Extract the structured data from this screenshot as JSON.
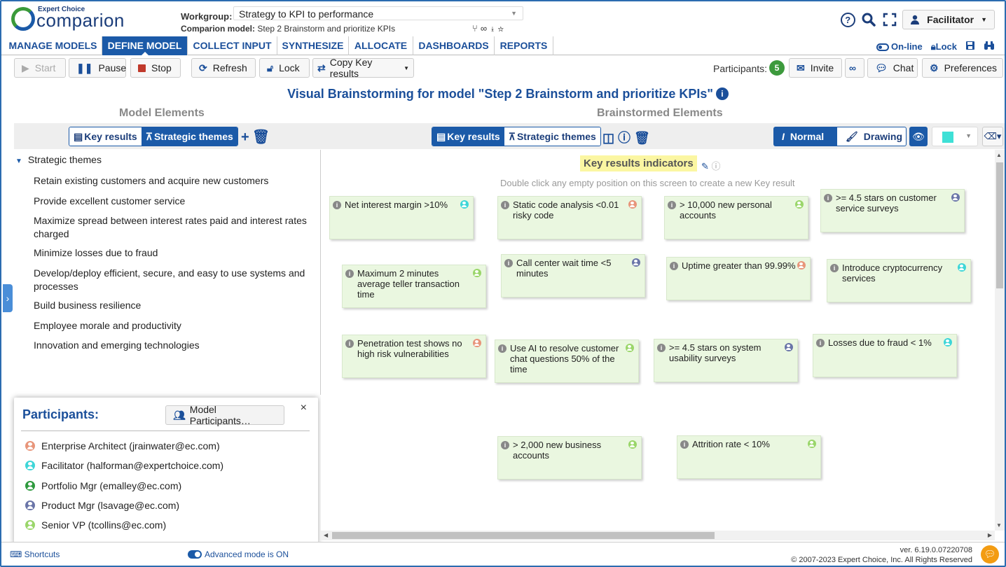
{
  "app": {
    "logo_small": "Expert Choice",
    "logo_big": "comparion"
  },
  "header": {
    "workgroup_label": "Workgroup:",
    "workgroup_value": "Strategy to KPI to performance",
    "model_label": "Comparion model:",
    "model_value": "Step 2 Brainstorm and prioritize KPIs",
    "user_label": "Facilitator"
  },
  "menu": {
    "items": [
      {
        "label": "MANAGE MODELS"
      },
      {
        "label": "DEFINE MODEL"
      },
      {
        "label": "COLLECT INPUT"
      },
      {
        "label": "SYNTHESIZE"
      },
      {
        "label": "ALLOCATE"
      },
      {
        "label": "DASHBOARDS"
      },
      {
        "label": "REPORTS"
      }
    ],
    "active_index": 1,
    "online": "On-line",
    "lock": "Lock"
  },
  "toolbar": {
    "start": "Start",
    "pause": "Pause",
    "stop": "Stop",
    "refresh": "Refresh",
    "lock": "Lock",
    "copy": "Copy Key results",
    "participants_label": "Participants:",
    "participants_count": "5",
    "invite": "Invite",
    "chat": "Chat",
    "preferences": "Preferences"
  },
  "page": {
    "title": "Visual Brainstorming for model \"Step 2 Brainstorm and prioritize KPIs\"",
    "model_elements": "Model Elements",
    "brainstormed_elements": "Brainstormed Elements"
  },
  "left": {
    "tab_key": "Key results",
    "tab_themes": "Strategic themes",
    "tree_root": "Strategic themes",
    "tree_items": [
      "Retain existing customers and acquire new customers",
      "Provide excellent customer service",
      "Maximize spread between interest rates paid and interest rates charged",
      "Minimize losses due to fraud",
      "Develop/deploy efficient, secure, and easy to use systems and processes",
      "Build business resilience",
      "Employee morale and productivity",
      "Innovation and emerging technologies"
    ]
  },
  "participants": {
    "title": "Participants:",
    "button": "Model Participants…",
    "close": "×",
    "list": [
      {
        "name": "Enterprise Architect (jrainwater@ec.com)",
        "color": "#e8957a"
      },
      {
        "name": "Facilitator (halforman@expertchoice.com)",
        "color": "#3ed6d8"
      },
      {
        "name": "Portfolio Mgr (emalley@ec.com)",
        "color": "#2e9a3e"
      },
      {
        "name": "Product Mgr (lsavage@ec.com)",
        "color": "#6a75a8"
      },
      {
        "name": "Senior VP (tcollins@ec.com)",
        "color": "#9ad66a"
      }
    ]
  },
  "right": {
    "tab_key": "Key results",
    "tab_themes": "Strategic themes",
    "normal": "Normal",
    "drawing": "Drawing",
    "accent": "#3ee0d6"
  },
  "canvas": {
    "section_title": "Key results indicators",
    "hint": "Double click any empty position on this screen to create a new Key result",
    "notes": [
      {
        "text": "Net interest margin >10%",
        "color": "#3ed6d8"
      },
      {
        "text": "Static code analysis <0.01 risky code",
        "color": "#e8957a"
      },
      {
        "text": "> 10,000 new personal accounts",
        "color": "#9ad66a"
      },
      {
        "text": ">= 4.5 stars on customer service surveys",
        "color": "#6a75a8"
      },
      {
        "text": "Maximum 2 minutes average teller transaction time",
        "color": "#9ad66a"
      },
      {
        "text": "Call center wait time <5 minutes",
        "color": "#6a75a8"
      },
      {
        "text": "Uptime greater than 99.99%",
        "color": "#e8957a"
      },
      {
        "text": "Introduce cryptocurrency services",
        "color": "#3ed6d8"
      },
      {
        "text": "Penetration test shows no high risk vulnerabilities",
        "color": "#e8957a"
      },
      {
        "text": "Use AI to resolve customer chat questions 50% of the time",
        "color": "#9ad66a"
      },
      {
        "text": ">= 4.5 stars on system usability surveys",
        "color": "#6a75a8"
      },
      {
        "text": "Losses due to fraud < 1%",
        "color": "#3ed6d8"
      },
      {
        "text": "> 2,000 new business accounts",
        "color": "#9ad66a"
      },
      {
        "text": "Attrition rate < 10%",
        "color": "#9ad66a"
      }
    ]
  },
  "footer": {
    "shortcuts": "Shortcuts",
    "advanced": "Advanced mode is ON",
    "version": "ver. 6.19.0.07220708",
    "copyright": "© 2007-2023 Expert Choice, Inc. All Rights Reserved"
  }
}
